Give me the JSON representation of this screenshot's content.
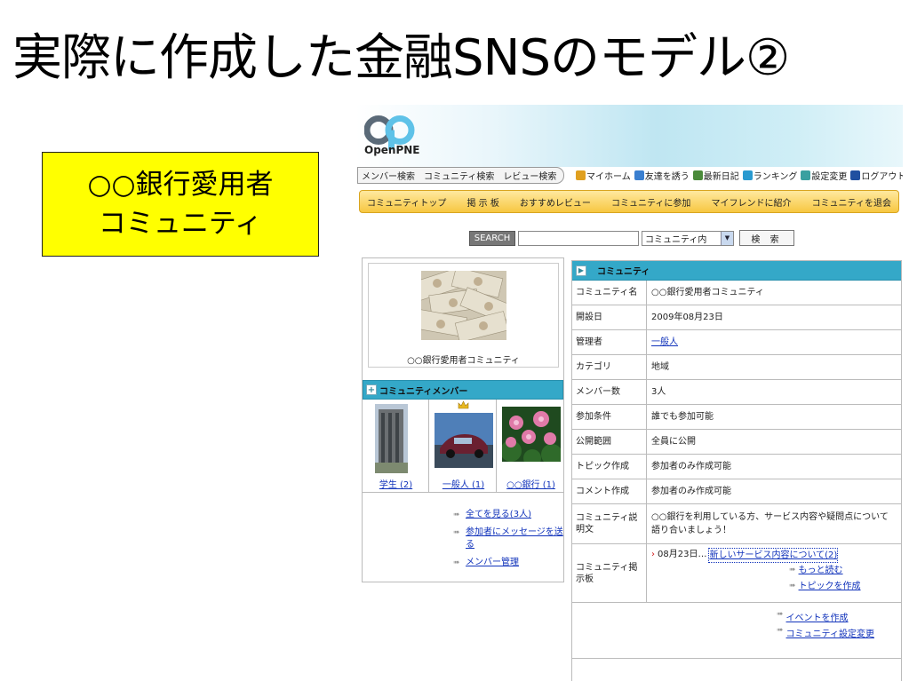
{
  "slide": {
    "title": "実際に作成した金融SNSのモデル②",
    "callout_line1": "○○銀行愛用者",
    "callout_line2": "コミュニティ"
  },
  "site": {
    "logo_text": "OpenPNE",
    "search_tabs": [
      "メンバー検索",
      "コミュニティ検索",
      "レビュー検索"
    ],
    "menu_links": [
      {
        "label": "マイホーム",
        "icon": "home-icon",
        "color": "#e0a020"
      },
      {
        "label": "友達を誘う",
        "icon": "invite-icon",
        "color": "#3a7fd0"
      },
      {
        "label": "最新日記",
        "icon": "pencil-icon",
        "color": "#4a8a3a"
      },
      {
        "label": "ランキング",
        "icon": "ranking-icon",
        "color": "#2a9ad0"
      },
      {
        "label": "設定変更",
        "icon": "gear-icon",
        "color": "#3aa0a0"
      },
      {
        "label": "ログアウト",
        "icon": "logout-icon",
        "color": "#2050a0"
      }
    ],
    "community_menu": [
      "コミュニティトップ",
      "掲 示 板",
      "おすすめレビュー",
      "コミュニティに参加",
      "マイフレンドに紹介",
      "コミュニティを退会"
    ],
    "search_button": "SEARCH",
    "search_value": "",
    "search_scope": "コミュニティ内",
    "find_button": "検 索"
  },
  "community": {
    "photo_caption": "○○銀行愛用者コミュニティ",
    "members_header": "コミュニティメンバー",
    "members": [
      {
        "name": "学生 (2)",
        "photo": "building"
      },
      {
        "name": "一般人 (1)",
        "photo": "car",
        "admin_icon": "crown-icon"
      },
      {
        "name": "○○銀行 (1)",
        "photo": "flowers"
      }
    ],
    "member_links": [
      "全てを見る(3人)",
      "参加者にメッセージを送る",
      "メンバー管理"
    ],
    "info_header": "コミュニティ",
    "rows": [
      {
        "k": "コミュニティ名",
        "v": "○○銀行愛用者コミュニティ"
      },
      {
        "k": "開設日",
        "v": "2009年08月23日"
      },
      {
        "k": "管理者",
        "v": "一般人",
        "link": true
      },
      {
        "k": "カテゴリ",
        "v": "地域"
      },
      {
        "k": "メンバー数",
        "v": "3人"
      },
      {
        "k": "参加条件",
        "v": "誰でも参加可能"
      },
      {
        "k": "公開範囲",
        "v": "全員に公開"
      },
      {
        "k": "トピック作成",
        "v": "参加者のみ作成可能"
      },
      {
        "k": "コメント作成",
        "v": "参加者のみ作成可能"
      }
    ],
    "description_label": "コミュニティ説明文",
    "description": "○○銀行を利用している方、サービス内容や疑問点について語り合いましょう！",
    "bbs_label": "コミュニティ掲示板",
    "bbs_date": "08月23日…",
    "bbs_topic": "新しいサービス内容について(2)",
    "bbs_more": "もっと読む",
    "bbs_create": "トピックを作成",
    "event_create": "イベントを作成",
    "settings_change": "コミュニティ設定変更"
  }
}
